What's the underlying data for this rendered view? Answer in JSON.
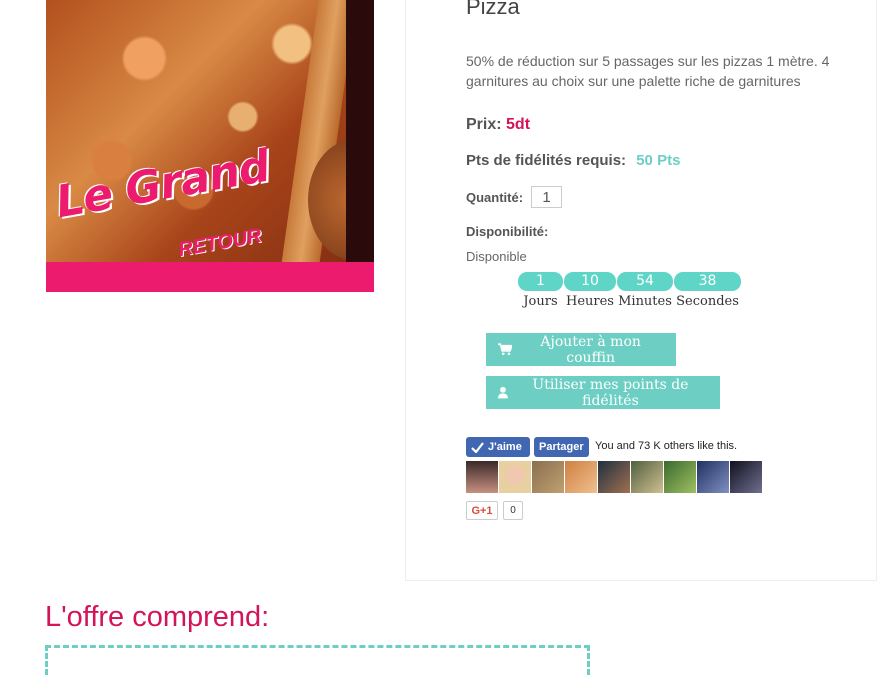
{
  "product": {
    "title": "Pizza",
    "description": "50% de réduction sur 5 passages sur les pizzas 1 mètre. 4 garnitures au choix sur une palette riche de garnitures",
    "image_text": {
      "line1": "Le Grand",
      "line2": "RETOUR"
    }
  },
  "price": {
    "label": "Prix:",
    "value": "5dt"
  },
  "loyalty": {
    "label": "Pts de fidélités requis:",
    "value": "50 Pts"
  },
  "quantity": {
    "label": "Quantité:",
    "value": "1"
  },
  "availability": {
    "label": "Disponibilité:",
    "value": "Disponible"
  },
  "countdown": [
    {
      "value": "1",
      "label": "Jours"
    },
    {
      "value": "10",
      "label": "Heures"
    },
    {
      "value": "54",
      "label": "Minutes"
    },
    {
      "value": "38",
      "label": "Secondes"
    }
  ],
  "buttons": {
    "cart": "Ajouter à mon couffin",
    "points": "Utiliser mes points de fidélités"
  },
  "social": {
    "like": "J'aime",
    "share": "Partager",
    "like_text": "You and 73 K others like this.",
    "gplus": "G+1",
    "gplus_count": "0"
  },
  "offer": {
    "heading": "L'offre comprend:"
  },
  "colors": {
    "accent": "#6dcfc4",
    "brand_pink": "#d4145a",
    "facebook": "#4267b2"
  }
}
